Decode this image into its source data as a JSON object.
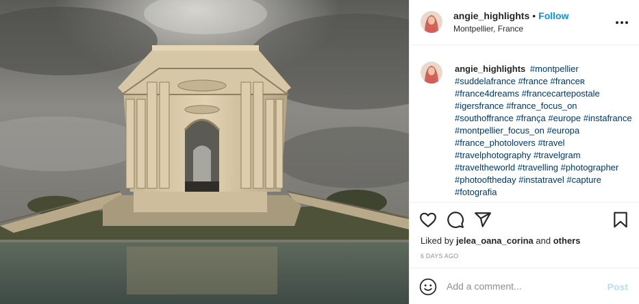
{
  "header": {
    "username": "angie_highlights",
    "separator": "•",
    "follow_label": "Follow",
    "location": "Montpellier, France",
    "more_icon": "more-horizontal-icon"
  },
  "caption": {
    "username": "angie_highlights",
    "hashtags": [
      "#montpellier",
      "#suddelafrance",
      "#france",
      "#franceʀ",
      "#france4dreams",
      "#francecartepostale",
      "#igersfrance",
      "#france_focus_on",
      "#southoffrance",
      "#frança",
      "#europe",
      "#instafrance",
      "#montpellier_focus_on",
      "#europa",
      "#france_photolovers",
      "#travel",
      "#travelphotography",
      "#travelgram",
      "#traveltheworld",
      "#travelling",
      "#photographer",
      "#photooftheday",
      "#instatravel",
      "#capture",
      "#fotografia"
    ]
  },
  "actions": {
    "like_icon": "heart-icon",
    "comment_icon": "comment-icon",
    "share_icon": "share-icon",
    "save_icon": "bookmark-icon"
  },
  "likes": {
    "prefix": "Liked by",
    "user": "jelea_oana_corina",
    "joiner": "and",
    "others": "others"
  },
  "timestamp": "6 DAYS AGO",
  "comment": {
    "placeholder": "Add a comment...",
    "post_label": "Post",
    "emoji_icon": "emoji-icon"
  }
}
